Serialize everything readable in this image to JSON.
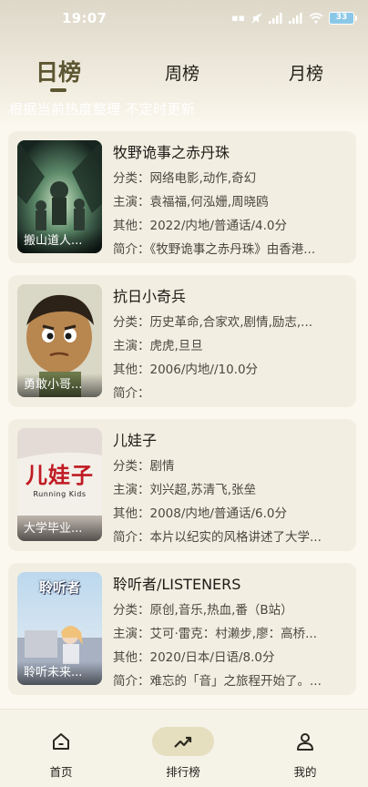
{
  "status_bar": {
    "time": "19:07",
    "battery": "33"
  },
  "tabs": [
    {
      "label": "日榜",
      "active": true
    },
    {
      "label": "周榜",
      "active": false
    },
    {
      "label": "月榜",
      "active": false
    }
  ],
  "subtitle": "根据当前热度整理 不定时更新",
  "items": [
    {
      "title": "牧野诡事之赤丹珠",
      "poster_caption": "搬山道人...",
      "category": "分类：网络电影,动作,奇幻",
      "cast": "主演：袁福福,何泓姗,周晓鸥",
      "other": "其他：2022/内地/普通话/4.0分",
      "summary": "简介：《牧野诡事之赤丹珠》由香港..."
    },
    {
      "title": "抗日小奇兵",
      "poster_caption": "勇敢小哥...",
      "category": "分类：历史革命,合家欢,剧情,励志,...",
      "cast": "主演：虎虎,旦旦",
      "other": "其他：2006/内地//10.0分",
      "summary": "简介："
    },
    {
      "title": "儿娃子",
      "poster_caption": "大学毕业...",
      "poster_text": "儿娃子",
      "poster_subtext": "Running Kids",
      "category": "分类：剧情",
      "cast": "主演：刘兴超,苏清飞,张垒",
      "other": "其他：2008/内地/普通话/6.0分",
      "summary": "简介：本片以纪实的风格讲述了大学..."
    },
    {
      "title": "聆听者/LISTENERS",
      "poster_caption": "聆听未来...",
      "poster_text": "聆听者",
      "category": "分类：原创,音乐,热血,番（B站）",
      "cast": "主演：艾可·雷克：村濑步,廖：高桥...",
      "other": "其他：2020/日本/日语/8.0分",
      "summary": "简介：难忘的「音」之旅程开始了。..."
    }
  ],
  "bottom_nav": [
    {
      "label": "首页",
      "icon": "home-icon",
      "active": false
    },
    {
      "label": "排行榜",
      "icon": "trending-icon",
      "active": true
    },
    {
      "label": "我的",
      "icon": "person-icon",
      "active": false
    }
  ]
}
